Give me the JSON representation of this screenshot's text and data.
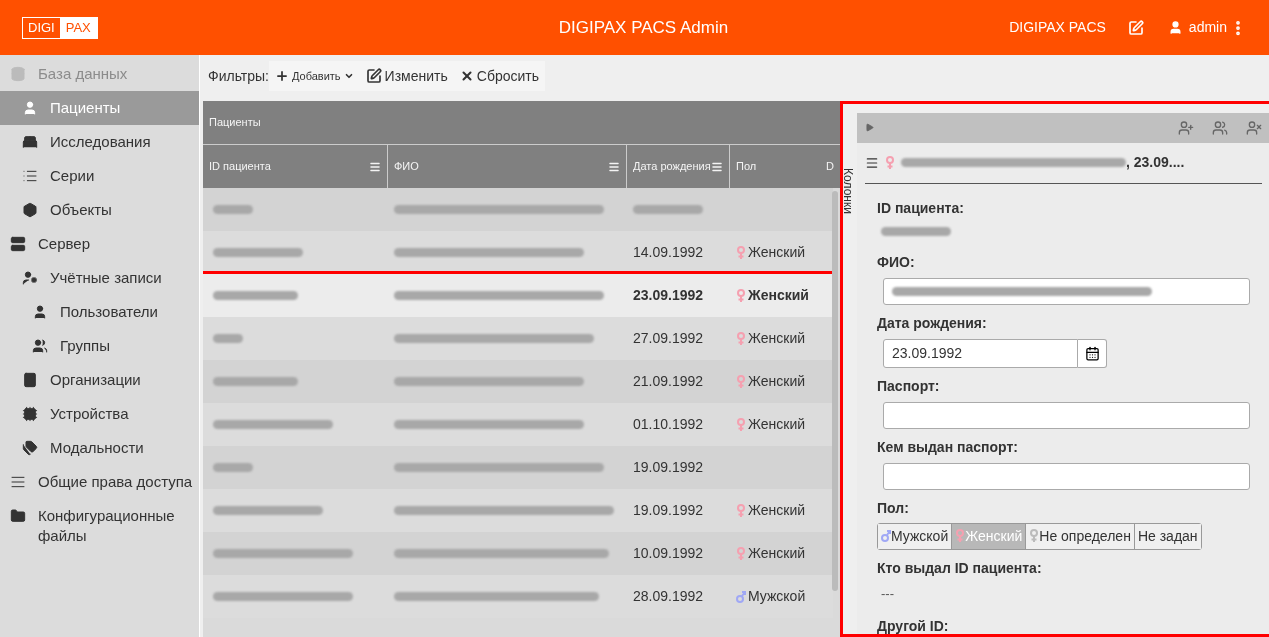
{
  "header": {
    "logo_left": "DIGI",
    "logo_right": "PAX",
    "title": "DIGIPAX PACS Admin",
    "app_link": "DIGIPAX PACS",
    "user": "admin"
  },
  "sidebar": {
    "items": [
      {
        "label": "База данных",
        "selected": false,
        "disabled": true,
        "children": [
          {
            "label": "Пациенты",
            "selected": true,
            "disabled": false
          },
          {
            "label": "Исследования",
            "selected": false,
            "disabled": false
          },
          {
            "label": "Серии",
            "selected": false,
            "disabled": false
          },
          {
            "label": "Объекты",
            "selected": false,
            "disabled": false
          }
        ]
      },
      {
        "label": "Сервер",
        "selected": false,
        "disabled": false,
        "children": [
          {
            "label": "Учётные записи",
            "selected": false,
            "disabled": false,
            "children": [
              {
                "label": "Пользователи",
                "selected": false,
                "disabled": false
              },
              {
                "label": "Группы",
                "selected": false,
                "disabled": false
              }
            ]
          },
          {
            "label": "Организации",
            "selected": false,
            "disabled": false
          },
          {
            "label": "Устройства",
            "selected": false,
            "disabled": false
          },
          {
            "label": "Модальности",
            "selected": false,
            "disabled": false
          }
        ]
      },
      {
        "label": "Общие права доступа",
        "selected": false,
        "disabled": false
      },
      {
        "label": "Конфигурационные файлы",
        "selected": false,
        "disabled": false
      }
    ]
  },
  "toolbar": {
    "label": "Фильтры:",
    "buttons": [
      {
        "label": "Добавить",
        "kind": "add"
      },
      {
        "label": "Изменить",
        "kind": "edit"
      },
      {
        "label": "Сбросить",
        "kind": "reset"
      }
    ]
  },
  "table": {
    "title": "Пациенты",
    "columns": [
      "ID пациента",
      "ФИО",
      "Дата рождения",
      "Пол",
      "D"
    ],
    "rows": [
      {
        "selected": false,
        "highlighted": false
      },
      {
        "birth": "14.09.1992",
        "sex": "Женский",
        "kind": "female",
        "selected": false,
        "highlighted": false
      },
      {
        "birth": "23.09.1992",
        "sex": "Женский",
        "kind": "female",
        "selected": true,
        "highlighted": true
      },
      {
        "birth": "27.09.1992",
        "sex": "Женский",
        "kind": "female",
        "selected": false,
        "highlighted": false
      },
      {
        "birth": "21.09.1992",
        "sex": "Женский",
        "kind": "female",
        "selected": false,
        "highlighted": false
      },
      {
        "birth": "01.10.1992",
        "sex": "Женский",
        "kind": "female",
        "selected": false,
        "highlighted": false
      },
      {
        "birth": "19.09.1992",
        "selected": false,
        "highlighted": false
      },
      {
        "birth": "19.09.1992",
        "sex": "Женский",
        "kind": "female",
        "selected": false,
        "highlighted": false
      },
      {
        "birth": "10.09.1992",
        "sex": "Женский",
        "kind": "female",
        "selected": false,
        "highlighted": false
      },
      {
        "birth": "28.09.1992",
        "sex": "Мужской",
        "kind": "male",
        "selected": false,
        "highlighted": false
      }
    ]
  },
  "panel": {
    "side_label": "Колонки",
    "highlighted": true,
    "title": {
      "kind": "female",
      "rest": ", 23.09...."
    },
    "fields": [
      {
        "kind": "redacted",
        "label": "ID пациента:"
      },
      {
        "kind": "input",
        "label": "ФИО:",
        "redacted": true
      },
      {
        "kind": "date",
        "label": "Дата рождения:",
        "value": "23.09.1992"
      },
      {
        "kind": "input",
        "label": "Паспорт:",
        "redacted": false
      },
      {
        "kind": "input",
        "label": "Кем выдан паспорт:",
        "redacted": false
      },
      {
        "kind": "gender",
        "label": "Пол:",
        "options": [
          {
            "label": "Мужской",
            "kind": "male",
            "selected": false
          },
          {
            "label": "Женский",
            "kind": "female",
            "selected": true
          },
          {
            "label": "Не определен",
            "kind": "other",
            "selected": false
          },
          {
            "label": "Не задан",
            "kind": "none",
            "selected": false
          }
        ]
      },
      {
        "kind": "static",
        "label": "Кто выдал ID пациента:",
        "value": "---"
      },
      {
        "kind": "label",
        "label": "Другой ID:"
      }
    ]
  }
}
